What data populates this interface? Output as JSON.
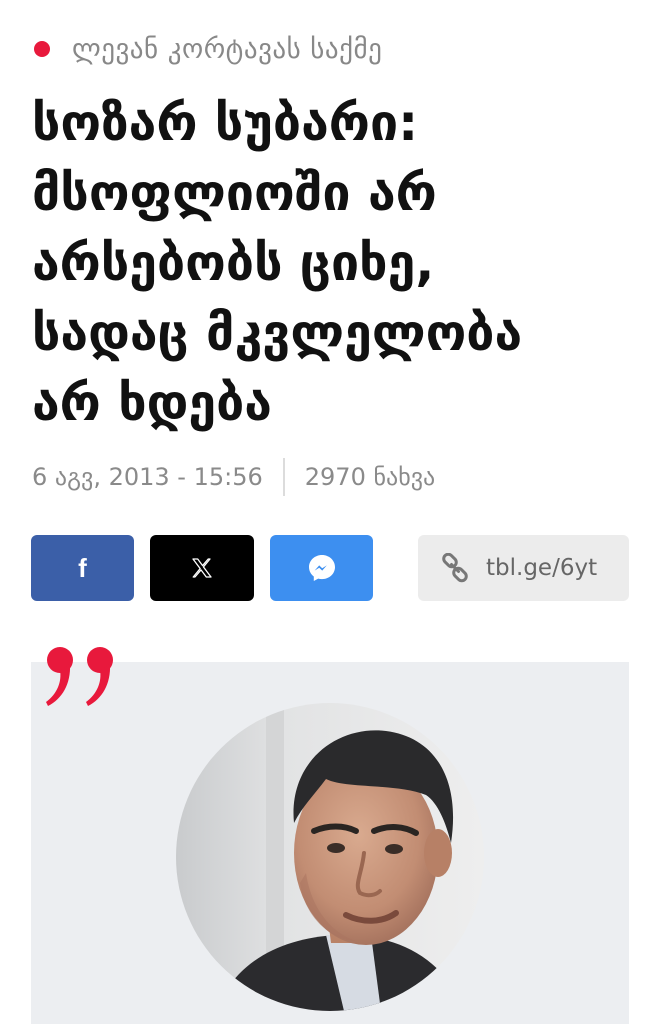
{
  "colors": {
    "accent": "#e8193c",
    "facebook": "#3b5fa8",
    "x": "#000000",
    "messenger": "#3d8ff0",
    "link_bg": "#ececec",
    "quote_bg": "#eceef1"
  },
  "article": {
    "category": "ლევან კორტავას საქმე",
    "title_lines": [
      "სოზარ სუბარი:",
      "მსოფლიოში არ",
      "არსებობს ციხე,",
      "სადაც მკვლელობა",
      "არ ხდება"
    ],
    "date": "6 აგვ, 2013 - 15:56",
    "views": "2970 ნახვა"
  },
  "share": {
    "facebook_icon": "facebook-icon",
    "x_icon": "x-icon",
    "messenger_icon": "messenger-icon",
    "link_icon": "link-icon",
    "short_link": "tbl.ge/6yt"
  },
  "quote": {
    "quote_icon": "quote-icon",
    "avatar": "person-photo"
  }
}
